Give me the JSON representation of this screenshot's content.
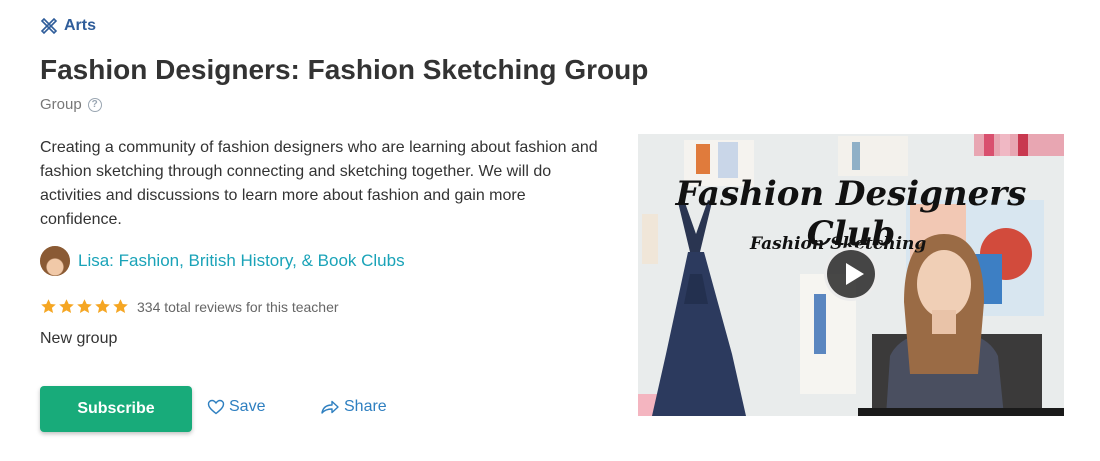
{
  "category": {
    "label": "Arts",
    "icon": "pencil-ruler-icon"
  },
  "title": "Fashion Designers: Fashion Sketching Group",
  "type": {
    "label": "Group",
    "help_icon": "question-circle-icon",
    "help_glyph": "?"
  },
  "description": "Creating a community of fashion designers who are learning about fashion and fashion sketching through connecting and sketching together. We will do activities and discussions to learn more about fashion and gain more confidence.",
  "teacher": {
    "name": "Lisa: Fashion, British History, & Book Clubs"
  },
  "reviews": {
    "rating": 5,
    "max": 5,
    "text": "334 total reviews for this teacher"
  },
  "status": "New group",
  "actions": {
    "subscribe": "Subscribe",
    "save": "Save",
    "share": "Share"
  },
  "video": {
    "title": "Fashion Designers Club",
    "subtitle": "Fashion Sketching",
    "play_icon": "play-icon"
  },
  "colors": {
    "accent": "#18ab7a",
    "category": "#2f5d9a",
    "link": "#1aa3b8",
    "action": "#2e7fc0",
    "star": "#f5a623"
  }
}
